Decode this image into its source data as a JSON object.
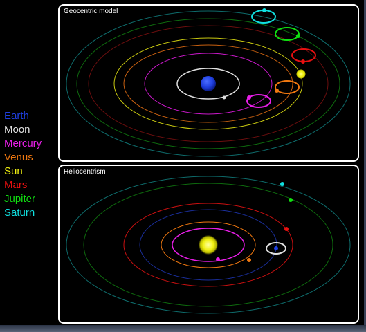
{
  "legend": [
    {
      "label": "Earth",
      "color": "#1f3fe0"
    },
    {
      "label": "Moon",
      "color": "#e0e0e0"
    },
    {
      "label": "Mercury",
      "color": "#e81ee8"
    },
    {
      "label": "Venus",
      "color": "#f07810"
    },
    {
      "label": "Sun",
      "color": "#f0f010"
    },
    {
      "label": "Mars",
      "color": "#e81010"
    },
    {
      "label": "Jupiter",
      "color": "#10e010"
    },
    {
      "label": "Saturn",
      "color": "#10e0e0"
    }
  ],
  "geocentric": {
    "title": "Geocentric model"
  },
  "heliocentric": {
    "title": "Heliocentrism"
  },
  "colors": {
    "earth": "#1f3fe0",
    "moon": "#e0e0e0",
    "mercury": "#e81ee8",
    "venus": "#f07810",
    "sun": "#f0f010",
    "mars": "#e81010",
    "jupiter": "#10e010",
    "saturn": "#10e0e0",
    "background": "#000000",
    "frame": "#ffffff"
  }
}
